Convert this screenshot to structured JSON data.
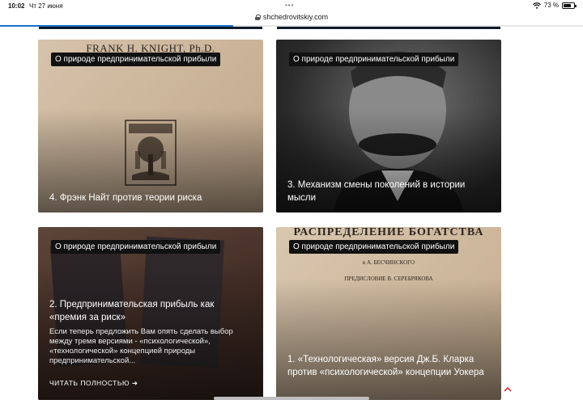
{
  "statusbar": {
    "time": "10:02",
    "date": "Чт 27 июня",
    "battery": "73 %",
    "battery_level": 0.73
  },
  "browser": {
    "url": "shchedrovitskiy.com",
    "load_progress": 0.4
  },
  "cards": [
    {
      "tag": "О природе предпринимательской прибыли",
      "title": "4. Фрэнк Найт против теории риска",
      "image_text": "FRANK H. KNIGHT, Ph.D."
    },
    {
      "tag": "О природе предпринимательской прибыли",
      "title": "3. Механизм смены поколений в истории мысли"
    },
    {
      "tag": "О природе предпринимательской прибыли",
      "title": "2. Предпринимательская прибыль как «премия за риск»",
      "excerpt": "Если теперь предложить Вам опять сделать выбор между тремя версиями - «психологической», «технологической» концепцией природы предпринимательской...",
      "read_more": "ЧИТАТЬ ПОЛНОСТЬЮ ➜"
    },
    {
      "tag": "О природе предпринимательской прибыли",
      "title": "1. «Технологическая» версия Дж.Б. Кларка против «психологической» концепции Уокера",
      "image_text": "РАСПРЕДЕЛЕНИЕ БОГАТСТВА",
      "image_line2": "в А. БЕСЧИНСКОГО",
      "image_line3": "ПРЕДИСЛОВИЕ В. СЕРЕБРЯКОВА"
    }
  ]
}
